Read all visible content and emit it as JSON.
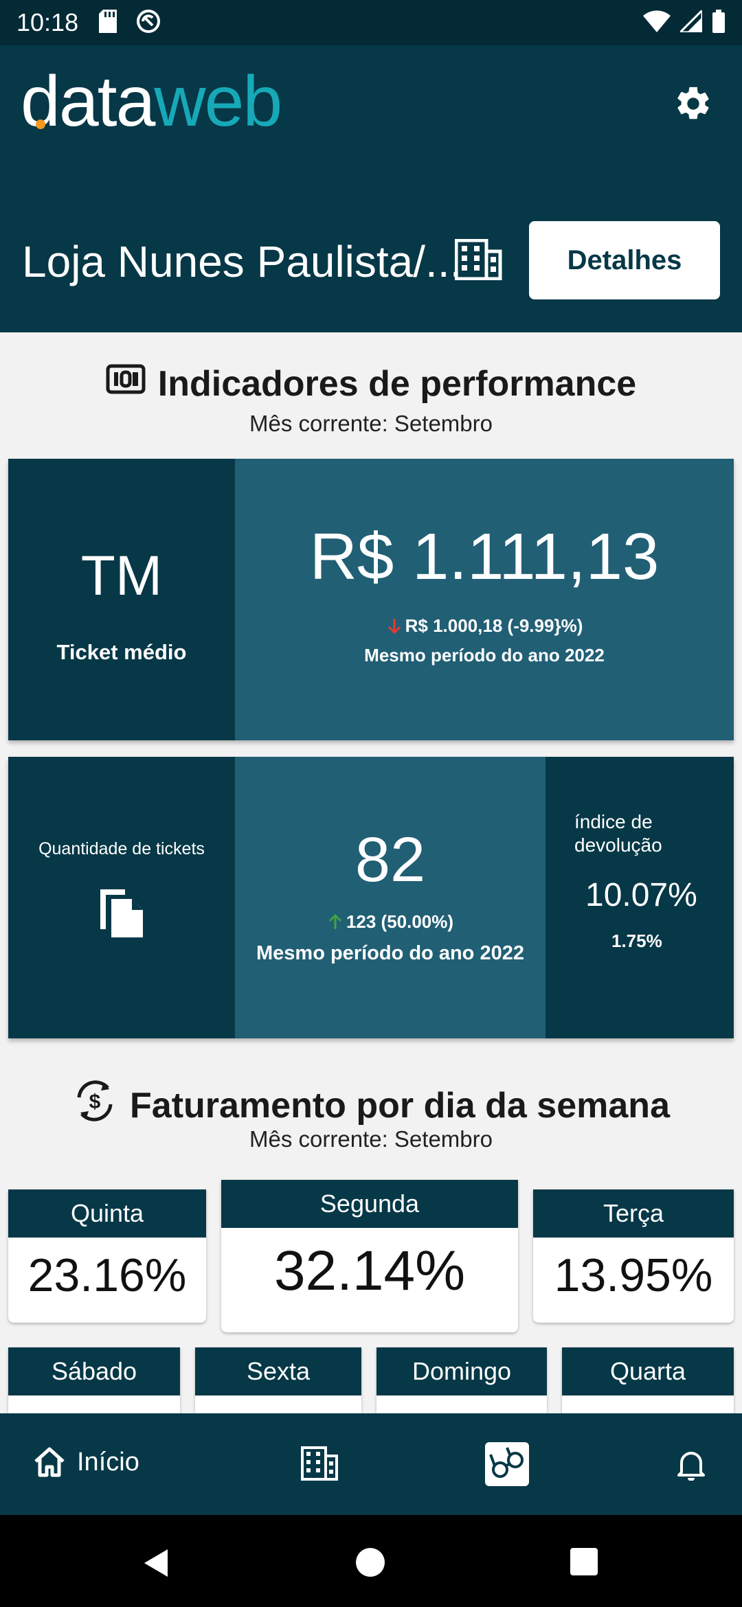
{
  "status_bar": {
    "time": "10:18"
  },
  "header": {
    "logo_part1": "data",
    "logo_part2": "web",
    "store_name": "Loja Nunes Paulista/...",
    "details_button": "Detalhes"
  },
  "performance": {
    "title": "Indicadores de performance",
    "subtitle": "Mês corrente: Setembro",
    "ticket_medio": {
      "abbr": "TM",
      "label": "Ticket médio",
      "value": "R$ 1.111,13",
      "compare": "R$ 1.000,18 (-9.99}%)",
      "period": "Mesmo período do ano 2022",
      "trend": "down"
    },
    "quantidade": {
      "label": "Quantidade de tickets",
      "value": "82",
      "compare": "123 (50.00%)",
      "period": "Mesmo período do ano 2022",
      "trend": "up"
    },
    "devolucao": {
      "label": "índice de devolução",
      "value": "10.07%",
      "sub": "1.75%"
    }
  },
  "faturamento": {
    "title": "Faturamento por dia da semana",
    "subtitle": "Mês corrente: Setembro",
    "days": [
      {
        "name": "Quinta",
        "value": "23.16%"
      },
      {
        "name": "Segunda",
        "value": "32.14%"
      },
      {
        "name": "Terça",
        "value": "13.95%"
      },
      {
        "name": "Sábado",
        "value": ""
      },
      {
        "name": "Sexta",
        "value": ""
      },
      {
        "name": "Domingo",
        "value": ""
      },
      {
        "name": "Quarta",
        "value": ""
      }
    ]
  },
  "bottom_nav": {
    "home_label": "Início"
  },
  "colors": {
    "primary_dark": "#073847",
    "primary_mid": "#215f75",
    "accent_teal": "#17a9b8",
    "accent_orange": "#f29a1d",
    "trend_down": "#e53935",
    "trend_up": "#43a047"
  }
}
